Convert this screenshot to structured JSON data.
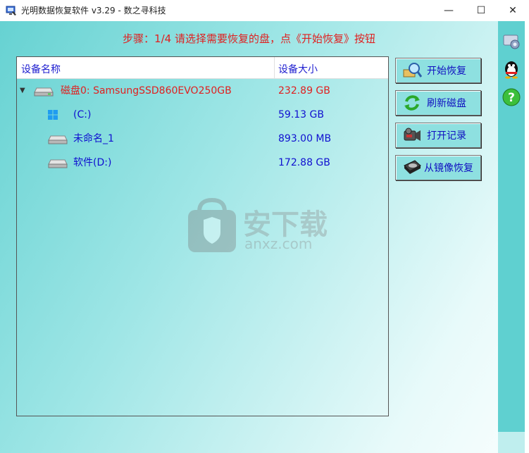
{
  "window": {
    "title": "光明数据恢复软件 v3.29 - 数之寻科技",
    "minimize_glyph": "—",
    "maximize_glyph": "☐",
    "close_glyph": "✕"
  },
  "step_text": "步骤：1/4 请选择需要恢复的盘，点《开始恢复》按钮",
  "table": {
    "headers": {
      "name": "设备名称",
      "size": "设备大小"
    },
    "rows": [
      {
        "name": "磁盘0: SamsungSSD860EVO250GB",
        "size": "232.89 GB",
        "color": "#e02020",
        "icon": "drive-icon",
        "level": 0
      },
      {
        "name": "(C:)",
        "size": "59.13 GB",
        "color": "#1010d0",
        "icon": "windows-icon",
        "level": 1
      },
      {
        "name": "未命名_1",
        "size": "893.00 MB",
        "color": "#1010d0",
        "icon": "drive-icon",
        "level": 1
      },
      {
        "name": "软件(D:)",
        "size": "172.88 GB",
        "color": "#1010d0",
        "icon": "drive-icon",
        "level": 1
      }
    ]
  },
  "buttons": {
    "start_recovery": "开始恢复",
    "refresh_disk": "刷新磁盘",
    "open_record": "打开记录",
    "image_recovery": "从镜像恢复"
  },
  "watermark": {
    "text": "安下载",
    "sub": "anxz.com"
  },
  "side_icons": [
    "settings-icon",
    "qq-penguin-icon",
    "help-icon"
  ]
}
